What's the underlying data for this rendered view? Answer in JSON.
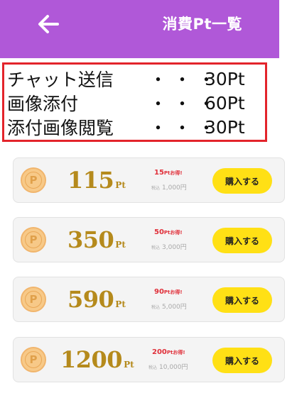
{
  "header": {
    "title": "消費Pt一覧",
    "back_icon": "arrow-left-icon"
  },
  "costs": [
    {
      "name": "チャット送信",
      "dots": "・・・",
      "value": "30Pt"
    },
    {
      "name": "画像添付",
      "dots": "・・・",
      "value": "60Pt"
    },
    {
      "name": "添付画像閲覧",
      "dots": "・・・",
      "value": "30Pt"
    }
  ],
  "packages": [
    {
      "coin": "P",
      "amount": "115",
      "unit": "Pt",
      "bonus_num": "15",
      "bonus_unit": "Pt",
      "bonus_text": "お得!",
      "tax_label": "税込",
      "price": "1,000円",
      "button": "購入する"
    },
    {
      "coin": "P",
      "amount": "350",
      "unit": "Pt",
      "bonus_num": "50",
      "bonus_unit": "Pt",
      "bonus_text": "お得!",
      "tax_label": "税込",
      "price": "3,000円",
      "button": "購入する"
    },
    {
      "coin": "P",
      "amount": "590",
      "unit": "Pt",
      "bonus_num": "90",
      "bonus_unit": "Pt",
      "bonus_text": "お得!",
      "tax_label": "税込",
      "price": "5,000円",
      "button": "購入する"
    },
    {
      "coin": "P",
      "amount": "1200",
      "unit": "Pt",
      "bonus_num": "200",
      "bonus_unit": "Pt",
      "bonus_text": "お得!",
      "tax_label": "税込",
      "price": "10,000円",
      "button": "購入する"
    }
  ],
  "colors": {
    "header_bg": "#b058d8",
    "box_border": "#e3242b",
    "amount": "#b58a1c",
    "bonus": "#e0303a",
    "button": "#ffe015"
  }
}
